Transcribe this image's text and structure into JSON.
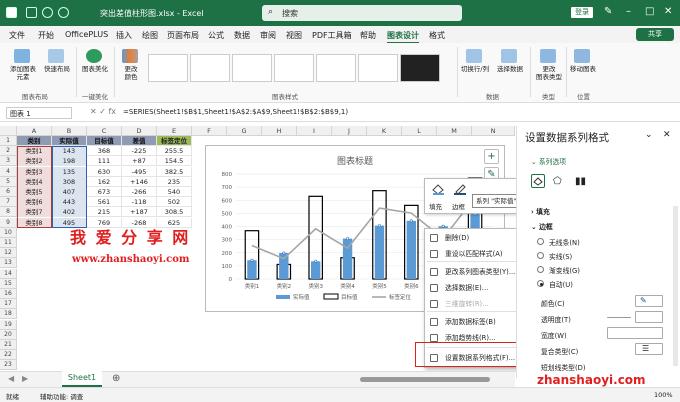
{
  "titlebar": {
    "filename": "突出差值柱形图.xlsx - Excel",
    "search": "搜索",
    "login": "登录"
  },
  "menus": [
    "文件",
    "开始",
    "OfficePLUS",
    "插入",
    "绘图",
    "页面布局",
    "公式",
    "数据",
    "审阅",
    "视图",
    "PDF工具箱",
    "帮助",
    "图表设计",
    "格式"
  ],
  "share": "共享",
  "ribbon": {
    "add_element": "添加图表\n元素",
    "quick_layout": "快速布局",
    "beautify": "图表美化",
    "change_colors": "更改\n颜色",
    "switch_row_col": "切换行/列",
    "select_data": "选择数据",
    "change_type": "更改\n图表类型",
    "move_chart": "移动图表",
    "groups": {
      "layout": "图表布局",
      "beautify": "一键美化",
      "styles": "图表样式",
      "data": "数据",
      "type": "类型",
      "location": "位置"
    }
  },
  "formula": {
    "namebox": "图表 1",
    "text": "=SERIES(Sheet1!$B$1,Sheet1!$A$2:$A$9,Sheet1!$B$2:$B$9,1)"
  },
  "columns": [
    "A",
    "B",
    "C",
    "D",
    "E",
    "F",
    "G",
    "H",
    "I",
    "J",
    "K",
    "L",
    "M",
    "N"
  ],
  "table": {
    "headers": [
      "类别",
      "实际值",
      "目标值",
      "差值",
      "标签定位"
    ],
    "rows": [
      [
        "类别1",
        "143",
        "368",
        "-225",
        "255.5"
      ],
      [
        "类别2",
        "198",
        "111",
        "+87",
        "154.5"
      ],
      [
        "类别3",
        "135",
        "630",
        "-495",
        "382.5"
      ],
      [
        "类别4",
        "308",
        "162",
        "+146",
        "235"
      ],
      [
        "类别5",
        "407",
        "673",
        "-266",
        "540"
      ],
      [
        "类别6",
        "443",
        "561",
        "-118",
        "502"
      ],
      [
        "类别7",
        "402",
        "215",
        "+187",
        "308.5"
      ],
      [
        "类别8",
        "495",
        "769",
        "-268",
        "625"
      ]
    ]
  },
  "watermark": {
    "cn": "我 爱 分 享 网",
    "url": "www.zhanshaoyi.com",
    "corner": "zhanshaoyi.com"
  },
  "chart": {
    "title_label": "图表标题",
    "legend": [
      "实际值",
      "目标值",
      "标签定位"
    ]
  },
  "chart_data": {
    "type": "bar",
    "title": "图表标题",
    "categories": [
      "类别1",
      "类别2",
      "类别3",
      "类别4",
      "类别5",
      "类别6",
      "类别7",
      "类别8"
    ],
    "series": [
      {
        "name": "实际值",
        "values": [
          143,
          198,
          135,
          308,
          407,
          443,
          402,
          495
        ]
      },
      {
        "name": "目标值",
        "values": [
          368,
          111,
          630,
          162,
          673,
          561,
          215,
          769
        ]
      },
      {
        "name": "标签定位",
        "values": [
          255.5,
          154.5,
          382.5,
          235,
          540,
          502,
          308.5,
          625
        ]
      }
    ],
    "ylim": [
      0,
      800
    ],
    "yticks": [
      "0",
      "100",
      "200",
      "300",
      "400",
      "500",
      "600",
      "700",
      "800"
    ],
    "grid": true,
    "legend": "bottom",
    "colors": {
      "actual": "#5b9bd5",
      "target": "#000000",
      "line": "#a6a6a6"
    }
  },
  "fill_outline": {
    "fill": "填充",
    "outline": "边框",
    "series_dd": "系列 \"实际值\""
  },
  "context_menu": [
    {
      "label": "删除(D)",
      "disabled": false
    },
    {
      "label": "重设以匹配样式(A)",
      "disabled": false
    },
    {
      "label": "更改系列图表类型(Y)...",
      "disabled": false
    },
    {
      "label": "选择数据(E)...",
      "disabled": false
    },
    {
      "label": "三维旋转(R)...",
      "disabled": true
    },
    {
      "label": "添加数据标签(B)",
      "disabled": false
    },
    {
      "label": "添加趋势线(R)...",
      "disabled": false
    },
    {
      "label": "设置数据系列格式(F)...",
      "disabled": false
    }
  ],
  "pane": {
    "title": "设置数据系列格式",
    "series_options": "系列选项",
    "fill": "填充",
    "border": "边框",
    "radios": [
      "无线条(N)",
      "实线(S)",
      "渐变线(G)",
      "自动(U)"
    ],
    "color": "颜色(C)",
    "transparency": "透明度(T)",
    "width": "宽度(W)",
    "compound": "复合类型(C)",
    "dash": "短划线类型(D)"
  },
  "sheet_tab": "Sheet1",
  "status": {
    "ready": "就绪",
    "accessibility": "辅助功能: 调查",
    "zoom": "100%"
  }
}
